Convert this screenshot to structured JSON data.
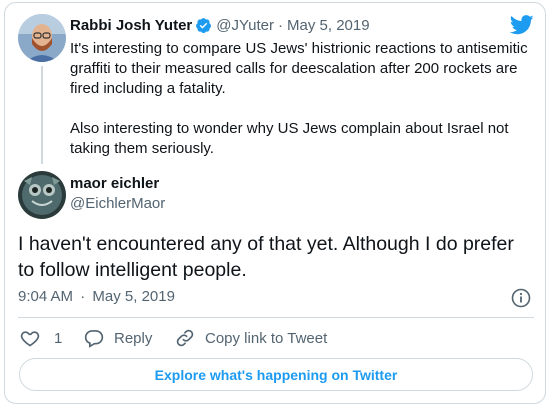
{
  "parent_tweet": {
    "author_name": "Rabbi Josh Yuter",
    "author_handle": "@JYuter",
    "separator": "·",
    "date": "May 5, 2019",
    "verified_icon": "verified-badge-icon",
    "text_line1": "It's interesting to compare US Jews' histrionic reactions to antisemitic",
    "text_line2": "graffiti to their measured calls for deescalation after 200 rockets are",
    "text_line3": "fired including a fatality.",
    "text_line4": "Also interesting to wonder why US Jews complain about Israel not",
    "text_line5": "taking them seriously."
  },
  "reply_tweet": {
    "author_name": "maor eichler",
    "author_handle": "@EichlerMaor",
    "text_line1": "I haven't encountered any of that yet. Although I do prefer",
    "text_line2": "to follow intelligent people.",
    "time": "9:04 AM",
    "separator": "·",
    "date": "May 5, 2019"
  },
  "actions": {
    "like_count": "1",
    "reply_label": "Reply",
    "copy_link_label": "Copy link to Tweet"
  },
  "explore_label": "Explore what's happening on Twitter",
  "icons": {
    "brand": "twitter-bird-icon",
    "info": "info-icon",
    "like": "heart-icon",
    "reply": "reply-bubble-icon",
    "link": "link-icon"
  },
  "colors": {
    "accent": "#1d9bf0",
    "text": "#0f1419",
    "muted": "#536471",
    "border": "#cfd9de"
  }
}
